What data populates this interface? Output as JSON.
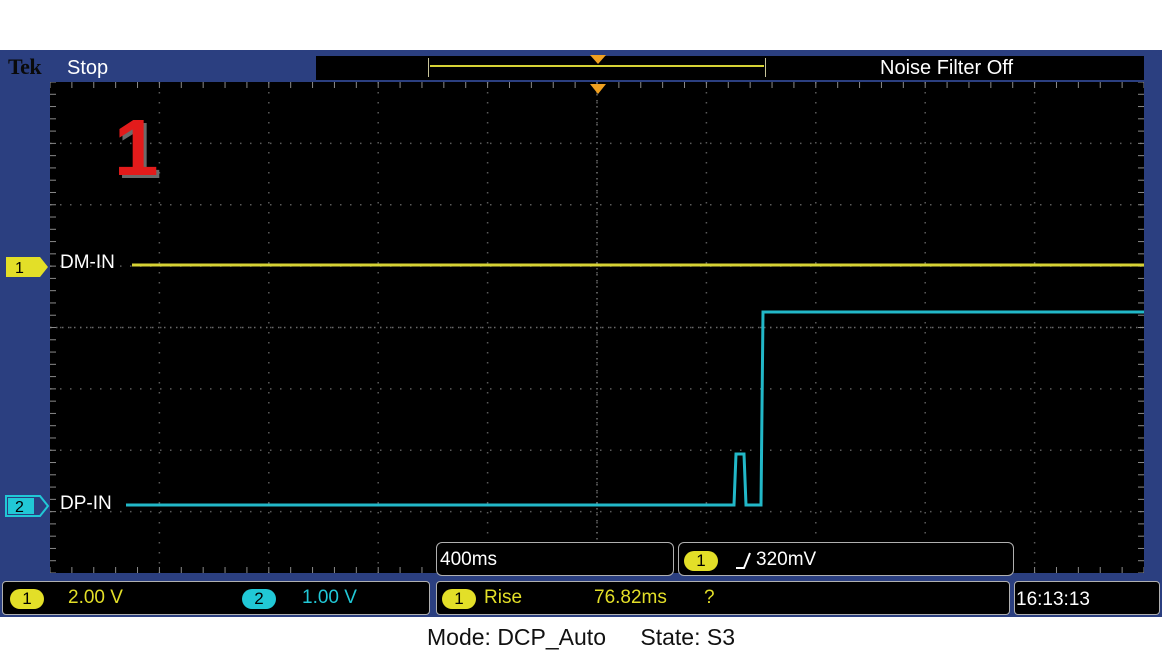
{
  "header": {
    "brand": "Tek",
    "run_state": "Stop",
    "noise_filter": "Noise Filter Off"
  },
  "screen": {
    "annotation_number": "1",
    "channels": [
      {
        "id": "1",
        "label": "DM-IN",
        "color": "#d6d235"
      },
      {
        "id": "2",
        "label": "DP-IN",
        "color": "#22b8c8"
      }
    ]
  },
  "readouts": {
    "timebase": "400ms",
    "trigger_channel": "1",
    "trigger_level": "320mV",
    "ch1_badge": "1",
    "ch1_scale": "2.00 V",
    "ch2_badge": "2",
    "ch2_scale": "1.00 V",
    "meas_badge": "1",
    "meas_name": "Rise",
    "meas_value": "76.82ms",
    "meas_flag": "?",
    "time": "16:13:13"
  },
  "caption": {
    "mode": "Mode: DCP_Auto",
    "state": "State: S3"
  },
  "colors": {
    "frame": "#2b3f80",
    "ch1": "#d6d235",
    "ch2": "#22b8c8",
    "annotation": "#e31b1b"
  }
}
